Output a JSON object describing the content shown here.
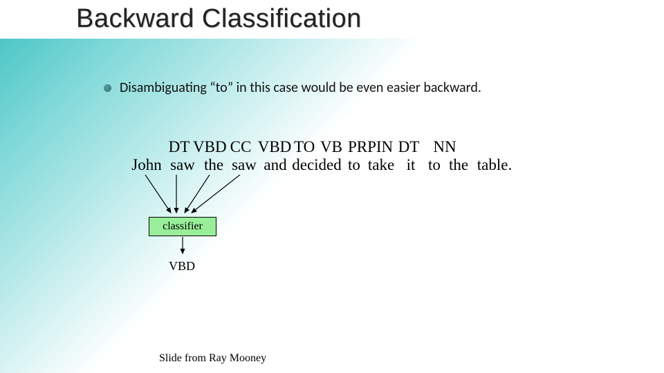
{
  "title": "Backward Classification",
  "bullet": "Disambiguating “to” in this case would be even easier backward.",
  "tags": [
    "",
    "",
    "DT",
    "VBD",
    "CC",
    "VBD",
    "TO",
    "VB",
    "PRP",
    "IN",
    "DT",
    "NN"
  ],
  "words": [
    "John",
    "saw",
    "the",
    "saw",
    "and",
    "decided",
    "to",
    "take",
    "it",
    "to",
    "the",
    "table."
  ],
  "classifier_label": "classifier",
  "output_tag": "VBD",
  "footer": "Slide from Ray Mooney"
}
